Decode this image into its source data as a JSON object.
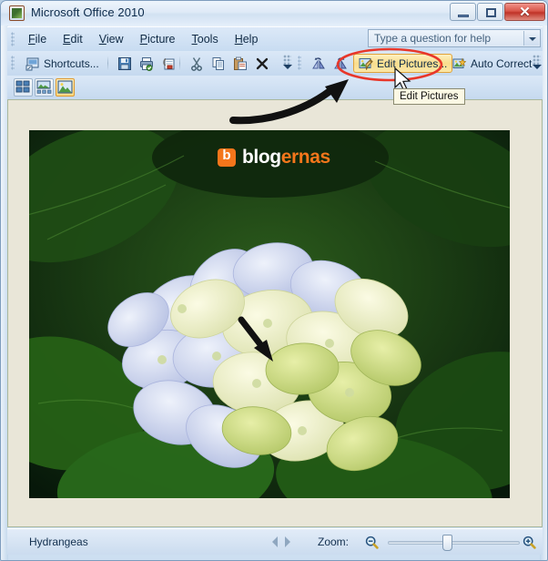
{
  "window": {
    "title": "Microsoft Office 2010",
    "icon": "picture-manager-icon",
    "controls": {
      "minimize": "–",
      "maximize": "□",
      "close": "✕"
    }
  },
  "menubar": {
    "items": [
      {
        "label": "File",
        "accel": "F"
      },
      {
        "label": "Edit",
        "accel": "E"
      },
      {
        "label": "View",
        "accel": "V"
      },
      {
        "label": "Picture",
        "accel": "P"
      },
      {
        "label": "Tools",
        "accel": "T"
      },
      {
        "label": "Help",
        "accel": "H"
      }
    ]
  },
  "help_box": {
    "placeholder": "Type a question for help",
    "value": ""
  },
  "toolbar": {
    "shortcuts_label": "Shortcuts...",
    "edit_pictures_label": "Edit Pictures...",
    "auto_correct_label": "Auto Correct",
    "icons": [
      "shortcuts-icon",
      "save-icon",
      "print-icon",
      "mail-attach-icon",
      "cut-icon",
      "copy-icon",
      "paste-icon",
      "delete-icon",
      "rotate-left-icon",
      "rotate-right-icon",
      "edit-pictures-icon",
      "auto-correct-icon"
    ],
    "view_buttons": [
      {
        "name": "thumbnail-view",
        "selected": false
      },
      {
        "name": "filmstrip-view",
        "selected": false
      },
      {
        "name": "single-picture-view",
        "selected": true
      }
    ]
  },
  "tooltip": {
    "text": "Edit Pictures"
  },
  "picture": {
    "watermark": {
      "logo_letter": "b",
      "text_primary": "blog",
      "text_accent": "ernas"
    },
    "alt": "Hydrangea flowers with green leaves"
  },
  "status": {
    "filename": "Hydrangeas",
    "prev_label": "Previous",
    "next_label": "Next",
    "zoom_label": "Zoom:",
    "zoom_out_icon": "zoom-out-icon",
    "zoom_in_icon": "zoom-in-icon",
    "zoom_percent": 42
  },
  "colors": {
    "accent_orange": "#f4761b",
    "highlight_amber": "#f9dd8d",
    "annotation_red": "#e8372a",
    "canvas": "#e9e6d8",
    "chrome_blue": "#cddff1"
  }
}
